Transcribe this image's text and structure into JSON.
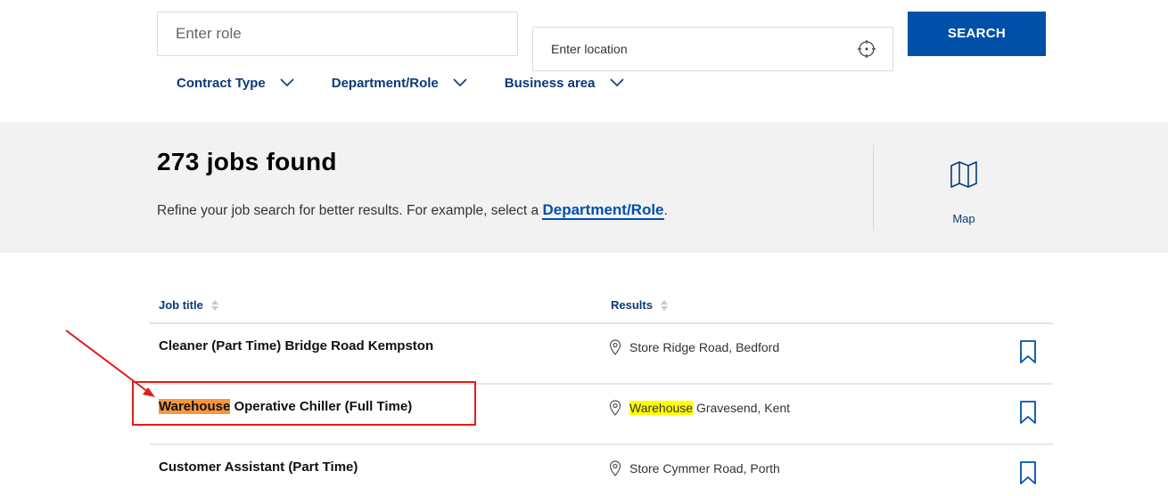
{
  "search": {
    "role_placeholder": "Enter role",
    "location_placeholder": "Enter location",
    "search_label": "SEARCH"
  },
  "filters": [
    {
      "label": "Contract Type"
    },
    {
      "label": "Department/Role"
    },
    {
      "label": "Business area"
    }
  ],
  "results": {
    "count_text": "273 jobs found",
    "refine_prefix": "Refine your job search for better results. For example, select a ",
    "refine_link": "Department/Role",
    "refine_suffix": ".",
    "map_label": "Map"
  },
  "table": {
    "columns": [
      {
        "label": "Job title"
      },
      {
        "label": "Results"
      }
    ],
    "rows": [
      {
        "title_highlight": "",
        "title": "Cleaner (Part Time) Bridge Road Kempston",
        "loc_highlight": "",
        "location": "Store Ridge Road, Bedford"
      },
      {
        "title_highlight": "Warehouse",
        "title": " Operative Chiller (Full Time)",
        "loc_highlight": "Warehouse",
        "location": " Gravesend, Kent"
      },
      {
        "title_highlight": "",
        "title": "Customer Assistant (Part Time)",
        "loc_highlight": "",
        "location": "Store Cymmer Road, Porth"
      }
    ]
  },
  "colors": {
    "brand_blue": "#0050aa",
    "nav_blue": "#0a3a78",
    "highlight_orange": "#f89640",
    "highlight_yellow": "#ffff00",
    "annotation_red": "#e31b1b"
  }
}
